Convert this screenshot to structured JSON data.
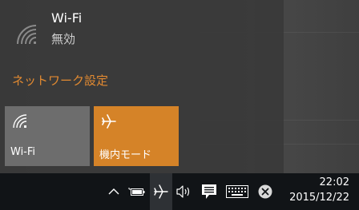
{
  "flyout": {
    "wifi_name": "Wi-Fi",
    "wifi_status": "無効",
    "network_settings_label": "ネットワーク設定",
    "accent_color": "#d58328",
    "tiles": [
      {
        "label": "Wi-Fi",
        "icon": "wifi-icon",
        "state": "off"
      },
      {
        "label": "機内モード",
        "icon": "airplane-icon",
        "state": "on"
      }
    ]
  },
  "taskbar": {
    "tray_icons": [
      "chevron-up-icon",
      "battery-icon",
      "airplane-icon",
      "volume-icon",
      "action-center-icon",
      "keyboard-icon",
      "close-circle-icon"
    ],
    "time": "22:02",
    "date": "2015/12/22"
  }
}
